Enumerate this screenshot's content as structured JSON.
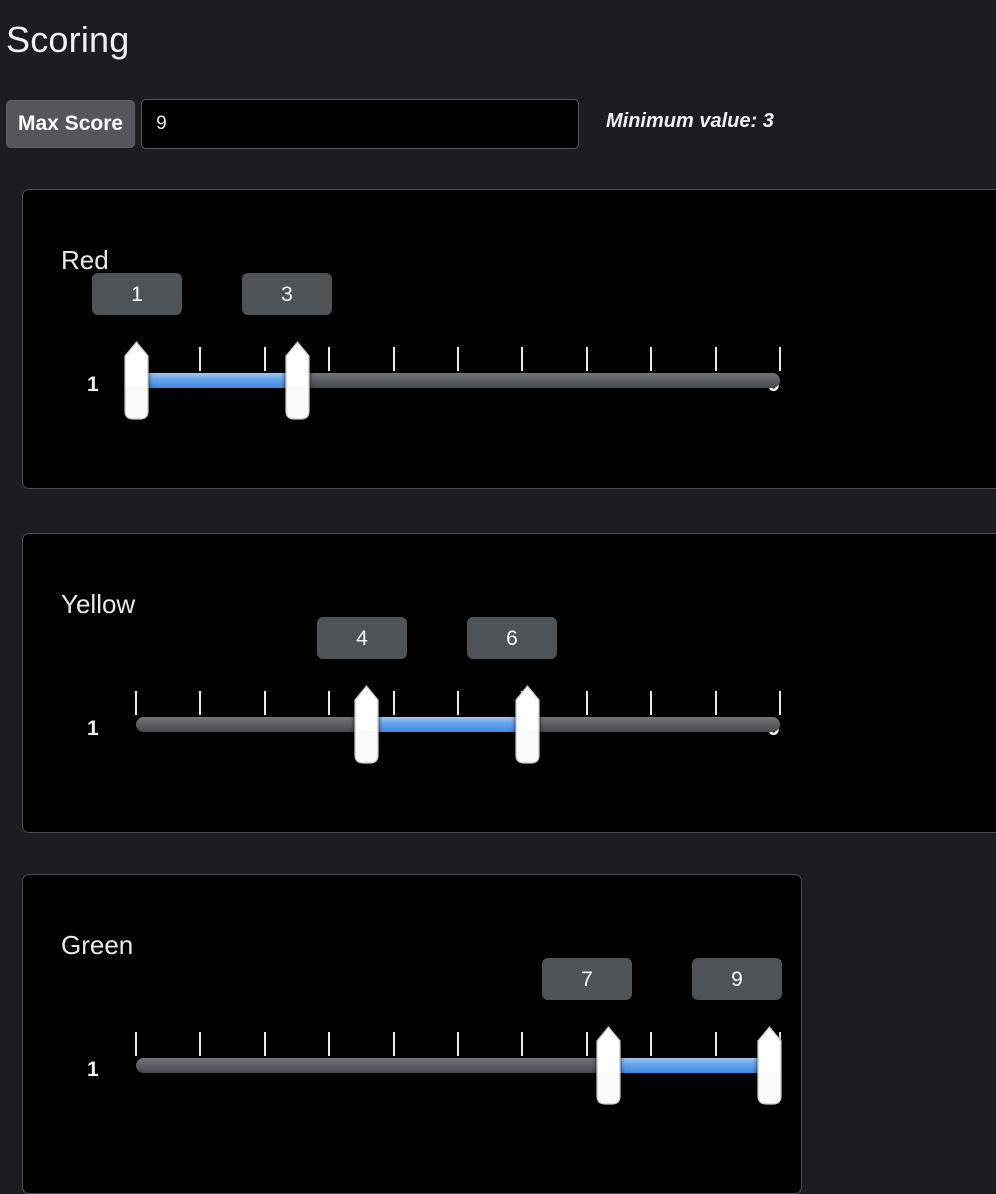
{
  "header": {
    "title": "Scoring",
    "max_score_label": "Max Score",
    "max_score_value": "9",
    "max_score_placeholder": "",
    "minimum_note": "Minimum value: 3"
  },
  "scale": {
    "min_label": "1",
    "max_label": "9",
    "min": 1,
    "max": 9,
    "tick_count": 11
  },
  "colors": {
    "page_background": "#1b1d20",
    "card_background": "#000000",
    "card_border": "#4b4f55",
    "bubble_background": "#4e5358",
    "track_gray": "#5c6065",
    "track_blue": "#64a4ec",
    "text": "#eaeaea"
  },
  "bands": [
    {
      "name": "red",
      "title": "Red",
      "low_value": "1",
      "high_value": "3",
      "min_label": "1",
      "max_label": "9",
      "low_pos": 0,
      "high_pos": 2.5
    },
    {
      "name": "yellow",
      "title": "Yellow",
      "low_value": "4",
      "high_value": "6",
      "min_label": "1",
      "max_label": "9",
      "low_pos": 3.58,
      "high_pos": 6.08
    },
    {
      "name": "green",
      "title": "Green",
      "low_value": "7",
      "high_value": "9",
      "min_label": "1",
      "max_label": "9",
      "low_pos": 7.33,
      "high_pos": 9.83
    }
  ]
}
